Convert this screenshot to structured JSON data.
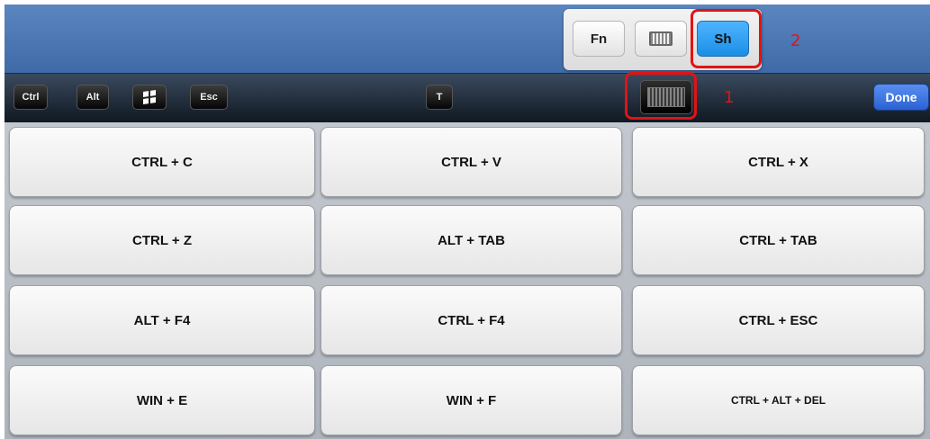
{
  "mode_switcher": {
    "fn_label": "Fn",
    "keyboard_icon": "keyboard-icon",
    "shortcuts_label": "Sh"
  },
  "annotations": {
    "callout_1": "1",
    "callout_2": "2"
  },
  "toolbar": {
    "ctrl_label": "Ctrl",
    "alt_label": "Alt",
    "windows_icon": "windows-logo-icon",
    "esc_label": "Esc",
    "t_label": "T",
    "keyboard_toggle_icon": "keyboard-icon",
    "done_label": "Done"
  },
  "shortcuts": [
    "CTRL + C",
    "CTRL + V",
    "CTRL + X",
    "CTRL + Z",
    "ALT + TAB",
    "CTRL + TAB",
    "ALT + F4",
    "CTRL + F4",
    "CTRL + ESC",
    "WIN + E",
    "WIN + F",
    "CTRL + ALT + DEL"
  ],
  "colors": {
    "title_bar": "#4a76b3",
    "active_mode": "#2aa0f5",
    "done_button": "#3a73e0",
    "callout": "#e01414"
  }
}
